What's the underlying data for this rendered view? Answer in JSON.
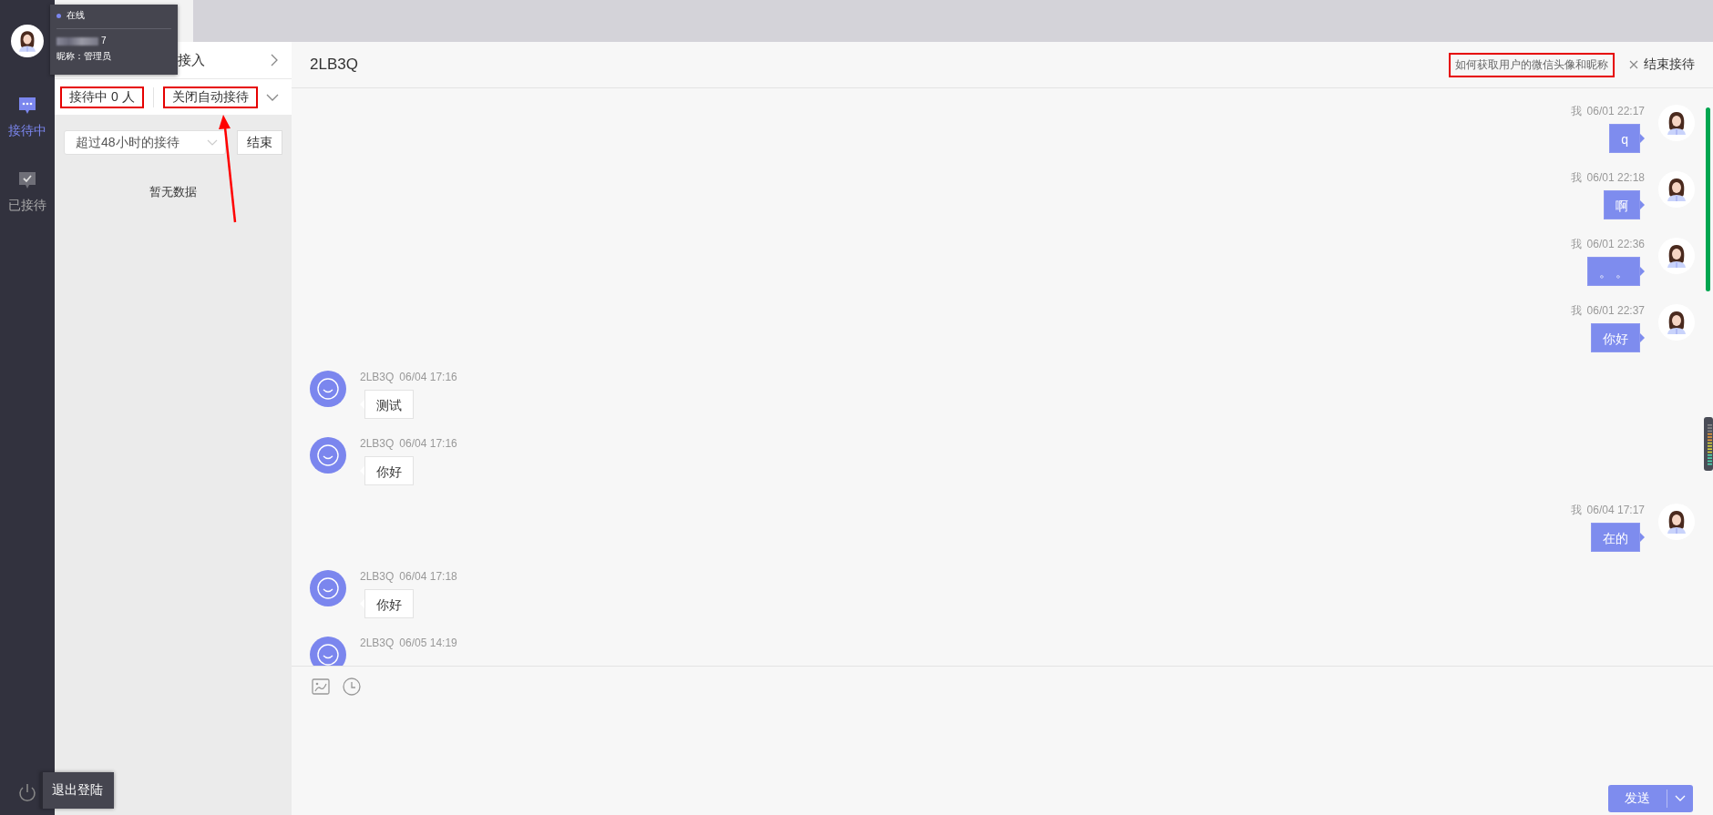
{
  "nav": {
    "items": [
      {
        "label": "接待中",
        "kind": "chat",
        "selected": true
      },
      {
        "label": "已接待",
        "kind": "check",
        "selected": false
      }
    ],
    "logout_tooltip": "退出登陆"
  },
  "status_popup": {
    "status": "在线",
    "account_suffix": "7",
    "nickname": "昵称：管理员"
  },
  "queue_panel": {
    "header": "接入",
    "serving_count": {
      "text": "接待中 0 人",
      "highlighted": true
    },
    "auto_toggle": {
      "text": "关闭自动接待",
      "highlighted": true
    },
    "filter": "超过48小时的接待",
    "end_button": "结束",
    "empty_text": "暂无数据"
  },
  "chat": {
    "title": "2LB3Q",
    "help_link": {
      "text": "如何获取用户的微信头像和昵称",
      "highlighted": true
    },
    "end_session": "结束接待",
    "messages": [
      {
        "kind": "agent",
        "sender": "我",
        "time": "06/01 22:17",
        "text": "q"
      },
      {
        "kind": "agent",
        "sender": "我",
        "time": "06/01 22:18",
        "text": "啊"
      },
      {
        "kind": "agent",
        "sender": "我",
        "time": "06/01 22:36",
        "text": "。 。"
      },
      {
        "kind": "agent",
        "sender": "我",
        "time": "06/01 22:37",
        "text": "你好"
      },
      {
        "kind": "customer",
        "sender": "2LB3Q",
        "time": "06/04 17:16",
        "text": "测试"
      },
      {
        "kind": "customer",
        "sender": "2LB3Q",
        "time": "06/04 17:16",
        "text": "你好"
      },
      {
        "kind": "agent",
        "sender": "我",
        "time": "06/04 17:17",
        "text": "在的"
      },
      {
        "kind": "customer",
        "sender": "2LB3Q",
        "time": "06/04 17:18",
        "text": "你好"
      },
      {
        "kind": "customer",
        "sender": "2LB3Q",
        "time": "06/05 14:19"
      }
    ],
    "send_button": "发送"
  }
}
